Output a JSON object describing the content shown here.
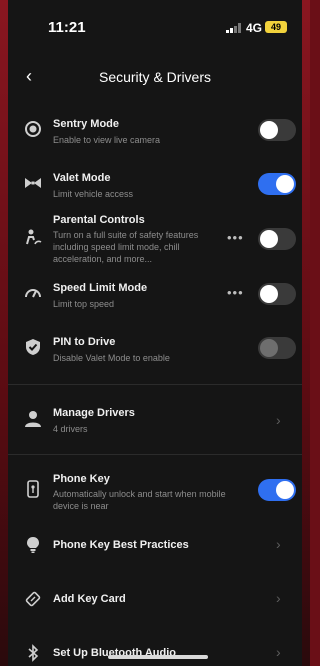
{
  "status": {
    "time": "11:21",
    "network": "4G",
    "battery": "49"
  },
  "header": {
    "title": "Security & Drivers",
    "back_icon": "chevron-left-icon"
  },
  "settings": [
    {
      "label": "Sentry Mode",
      "sub": "Enable to view live camera",
      "icon": "sentry-icon",
      "toggle": "off"
    },
    {
      "label": "Valet Mode",
      "sub": "Limit vehicle access",
      "icon": "valet-bowtie-icon",
      "toggle": "on"
    },
    {
      "label": "Parental Controls",
      "sub": "Turn on a full suite of safety features including speed limit mode, chill acceleration, and more...",
      "icon": "parental-icon",
      "toggle": "off"
    },
    {
      "label": "Speed Limit Mode",
      "sub": "Limit top speed",
      "icon": "speedometer-icon",
      "toggle": "off"
    },
    {
      "label": "PIN to Drive",
      "sub": "Disable Valet Mode to enable",
      "icon": "shield-check-icon",
      "toggle": "disabled"
    }
  ],
  "drivers": {
    "label": "Manage Drivers",
    "sub": "4 drivers"
  },
  "phone_key": {
    "label": "Phone Key",
    "sub": "Automatically unlock and start when mobile device is near",
    "toggle": "on"
  },
  "links": [
    {
      "label": "Phone Key Best Practices",
      "icon": "lightbulb-icon"
    },
    {
      "label": "Add Key Card",
      "icon": "key-card-icon"
    },
    {
      "label": "Set Up Bluetooth Audio",
      "icon": "bluetooth-icon"
    }
  ],
  "colors": {
    "accent": "#2f6ff0",
    "background": "#151515",
    "battery": "#f2d23c"
  }
}
